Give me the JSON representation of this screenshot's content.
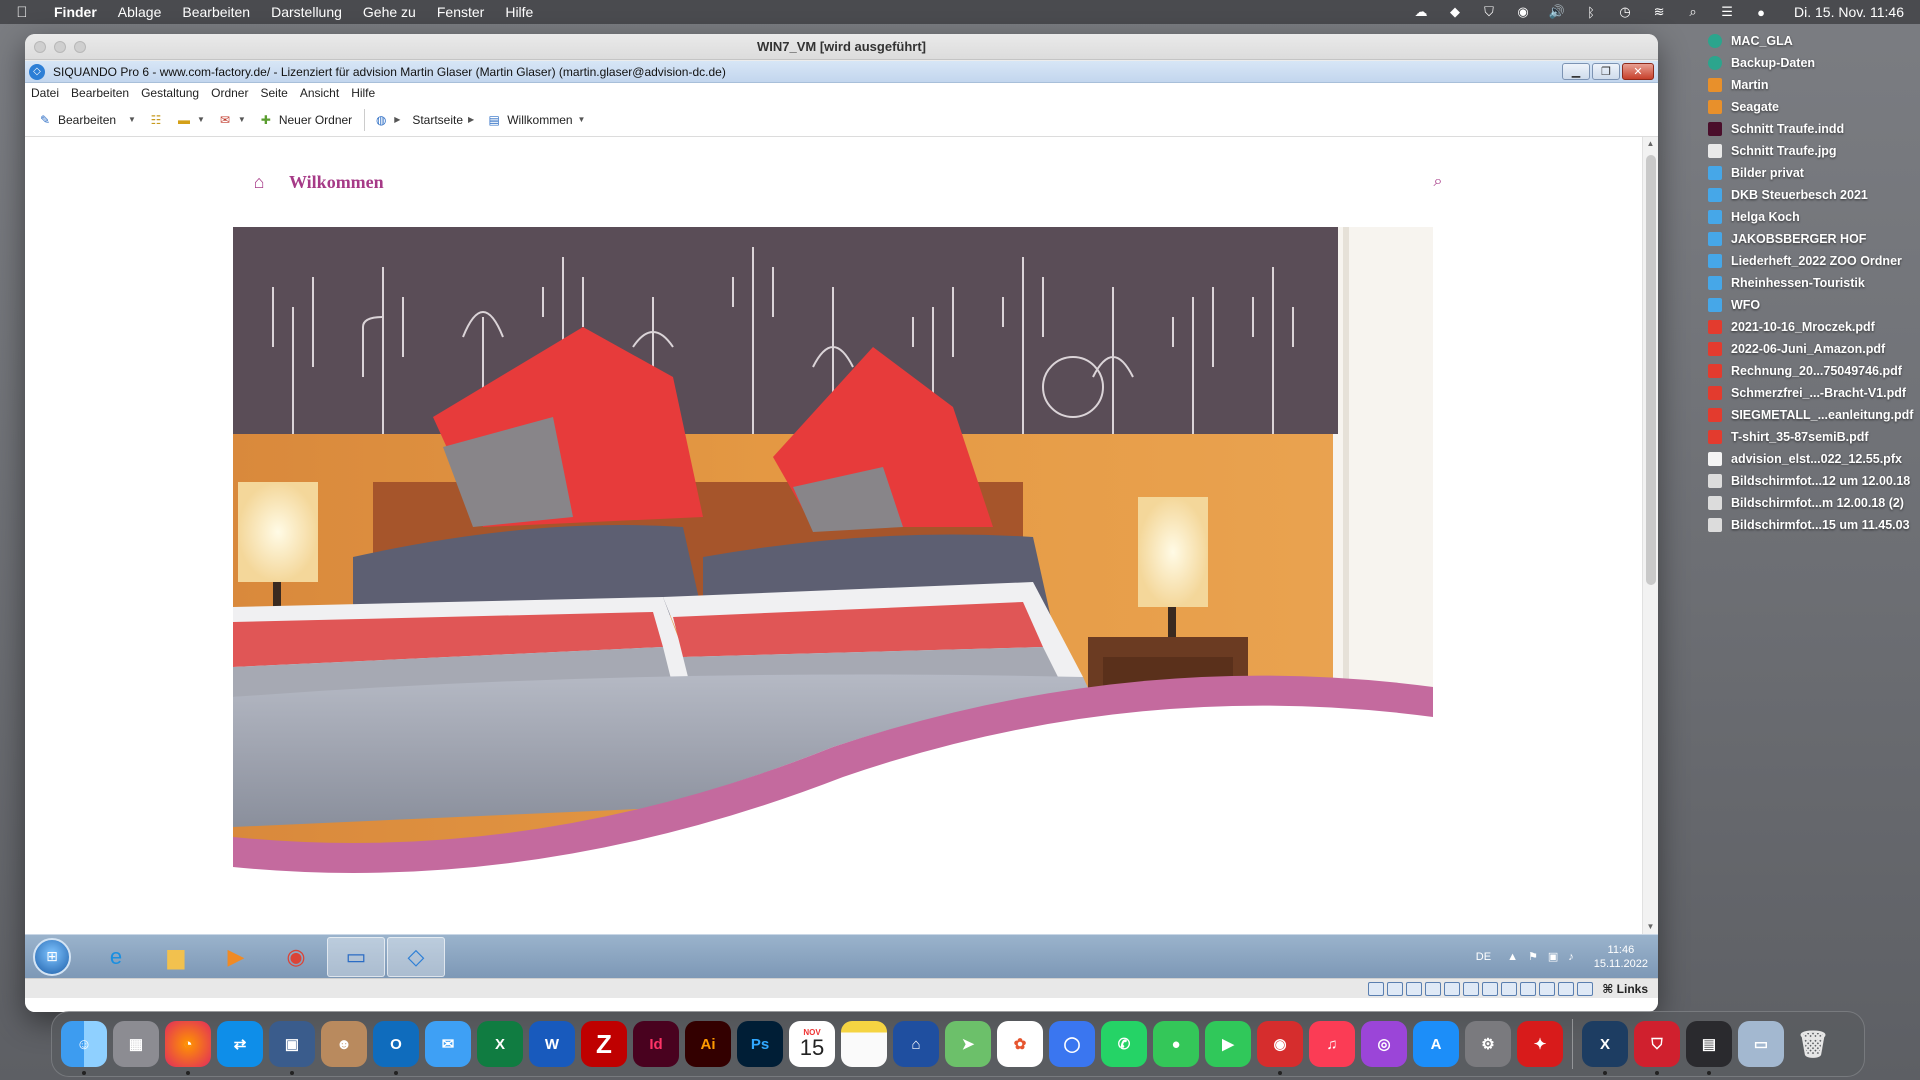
{
  "mac_menubar": {
    "app_name": "Finder",
    "items": [
      "Ablage",
      "Bearbeiten",
      "Darstellung",
      "Gehe zu",
      "Fenster",
      "Hilfe"
    ],
    "datetime": "Di. 15. Nov.  11:46"
  },
  "vm_window": {
    "title": "WIN7_VM [wird ausgeführt]"
  },
  "app": {
    "caption": "SIQUANDO Pro 6 - www.com-factory.de/ - Lizenziert für advision Martin Glaser (Martin Glaser) (martin.glaser@advision-dc.de)",
    "menu": [
      "Datei",
      "Bearbeiten",
      "Gestaltung",
      "Ordner",
      "Seite",
      "Ansicht",
      "Hilfe"
    ],
    "toolbar": {
      "edit_label": "Bearbeiten",
      "new_folder_label": "Neuer Ordner",
      "breadcrumb_home": "Startseite",
      "breadcrumb_page": "Willkommen"
    }
  },
  "site": {
    "title": "Wilkommen",
    "accent": "#a63a87",
    "wave_color": "#c46a9e"
  },
  "win_taskbar": {
    "lang": "DE",
    "time": "11:46",
    "date": "15.11.2022"
  },
  "vm_status": {
    "links_label": "⌘ Links"
  },
  "desktop": {
    "items": [
      {
        "label": "MAC_GLA",
        "icon": "server-icon"
      },
      {
        "label": "Backup-Daten",
        "icon": "server-icon"
      },
      {
        "label": "Martin",
        "icon": "drive-icon"
      },
      {
        "label": "Seagate",
        "icon": "drive-icon"
      },
      {
        "label": "Schnitt Traufe.indd",
        "icon": "indesign-file-icon"
      },
      {
        "label": "Schnitt Traufe.jpg",
        "icon": "image-file-icon"
      },
      {
        "label": "Bilder privat",
        "icon": "folder-icon"
      },
      {
        "label": "DKB Steuerbesch 2021",
        "icon": "folder-icon"
      },
      {
        "label": "Helga Koch",
        "icon": "folder-icon"
      },
      {
        "label": "JAKOBSBERGER HOF",
        "icon": "folder-icon"
      },
      {
        "label": "Liederheft_2022 ZOO Ordner",
        "icon": "folder-icon"
      },
      {
        "label": "Rheinhessen-Touristik",
        "icon": "folder-icon"
      },
      {
        "label": "WFO",
        "icon": "folder-icon"
      },
      {
        "label": "2021-10-16_Mroczek.pdf",
        "icon": "pdf-file-icon"
      },
      {
        "label": "2022-06-Juni_Amazon.pdf",
        "icon": "pdf-file-icon"
      },
      {
        "label": "Rechnung_20...75049746.pdf",
        "icon": "pdf-file-icon"
      },
      {
        "label": "Schmerzfrei_...-Bracht-V1.pdf",
        "icon": "pdf-file-icon"
      },
      {
        "label": "SIEGMETALL_...eanleitung.pdf",
        "icon": "pdf-file-icon"
      },
      {
        "label": "T-shirt_35-87semiB.pdf",
        "icon": "pdf-file-icon"
      },
      {
        "label": "advision_elst...022_12.55.pfx",
        "icon": "document-file-icon"
      },
      {
        "label": "Bildschirmfot...12 um 12.00.18",
        "icon": "screenshot-file-icon"
      },
      {
        "label": "Bildschirmfot...m 12.00.18 (2)",
        "icon": "screenshot-file-icon"
      },
      {
        "label": "Bildschirmfot...15 um 11.45.03",
        "icon": "screenshot-file-icon"
      }
    ]
  },
  "dock": {
    "calendar_month": "NOV",
    "calendar_day": "15",
    "labels": {
      "indesign": "Id",
      "illustrator": "Ai",
      "photoshop": "Ps",
      "word": "W",
      "excel": "X",
      "outlook": "O"
    }
  }
}
